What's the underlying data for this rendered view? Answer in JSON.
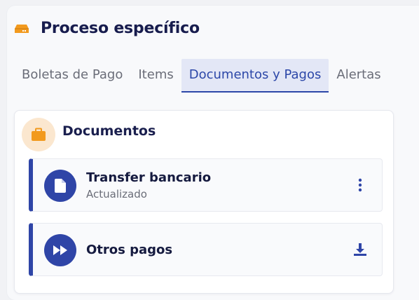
{
  "header": {
    "title": "Proceso específico",
    "icon": "box-icon",
    "icon_color": "#f29a1e"
  },
  "tabs": [
    {
      "label": "Boletas de Pago",
      "active": false
    },
    {
      "label": "Items",
      "active": false
    },
    {
      "label": "Documentos y Pagos",
      "active": true
    },
    {
      "label": "Alertas",
      "active": false
    }
  ],
  "documents_card": {
    "title": "Documentos",
    "icon": "briefcase-icon",
    "items": [
      {
        "title": "Transfer bancario",
        "subtitle": "Actualizado",
        "icon": "document-icon",
        "action_icon": "more-vertical-icon"
      },
      {
        "title": "Otros pagos",
        "subtitle": "",
        "icon": "fast-forward-icon",
        "action_icon": "download-icon"
      }
    ]
  },
  "colors": {
    "accent": "#2f45a7",
    "orange": "#f29a1e",
    "tab_active_bg": "#e3e7f6"
  }
}
